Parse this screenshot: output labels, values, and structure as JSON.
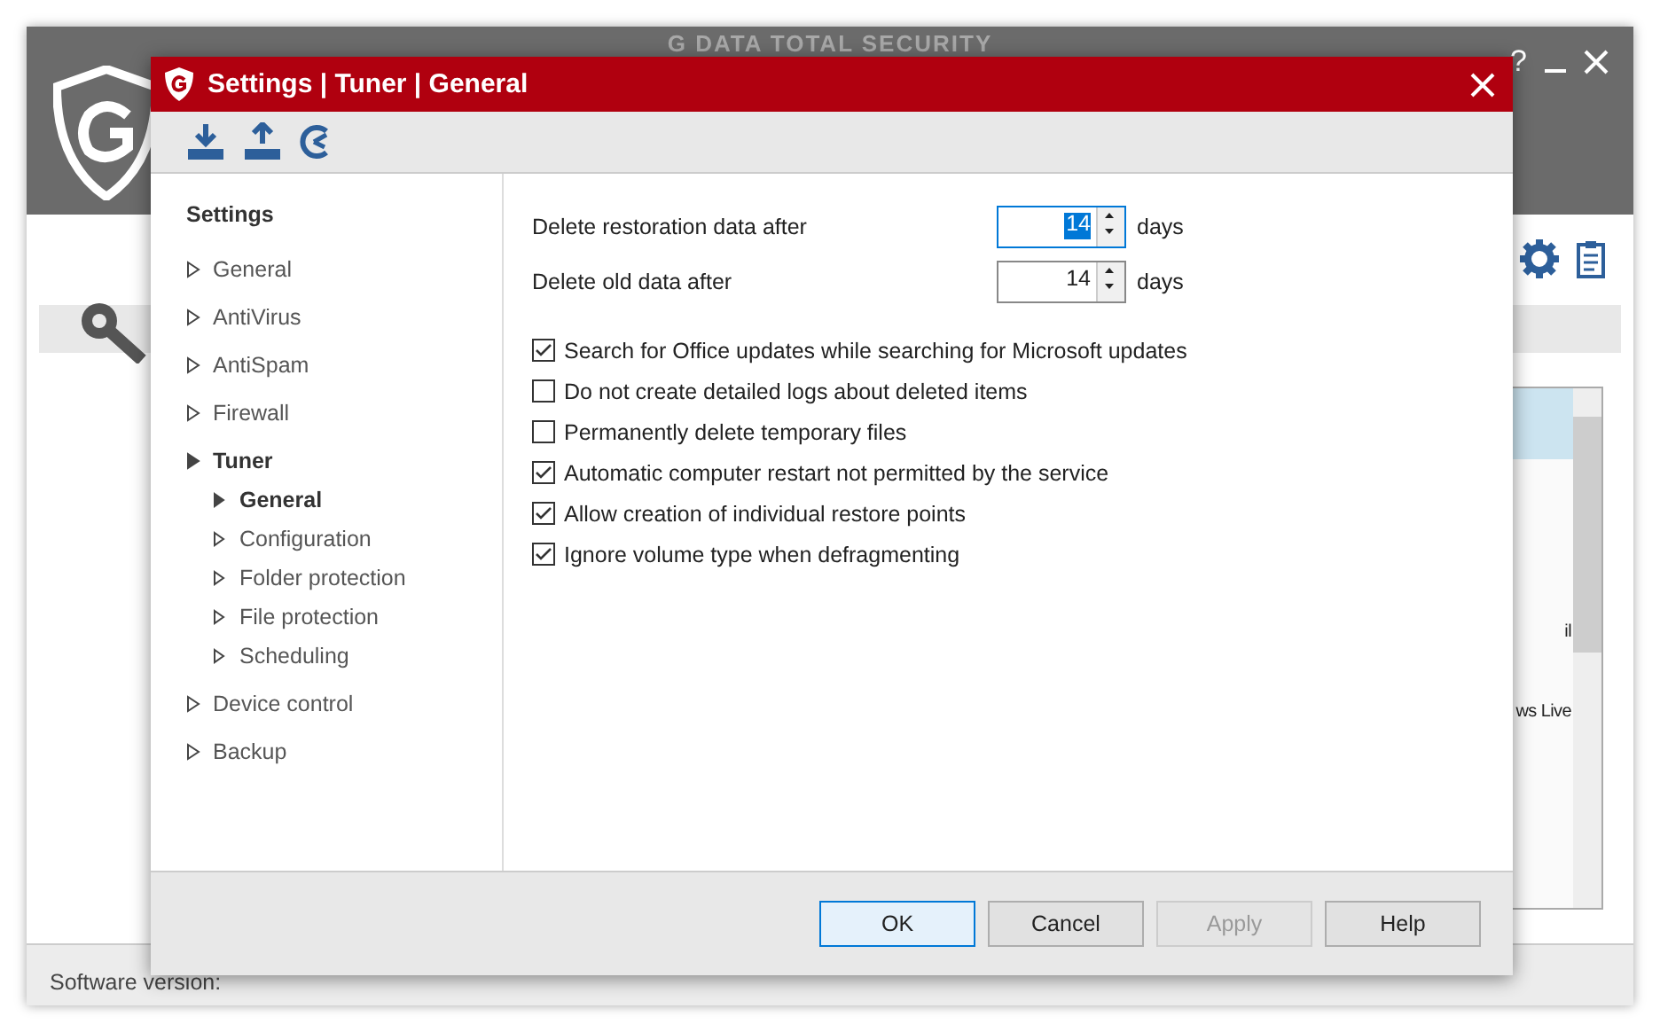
{
  "background_window": {
    "title": "G DATA TOTAL SECURITY",
    "help_label": "?",
    "list_items": [
      "il",
      "ws Live"
    ],
    "status": "Software version:"
  },
  "dialog": {
    "title": "Settings | Tuner | General",
    "nav": {
      "heading": "Settings",
      "items": [
        {
          "label": "General",
          "expanded": false
        },
        {
          "label": "AntiVirus",
          "expanded": false
        },
        {
          "label": "AntiSpam",
          "expanded": false
        },
        {
          "label": "Firewall",
          "expanded": false
        },
        {
          "label": "Tuner",
          "expanded": true,
          "children": [
            {
              "label": "General",
              "selected": true
            },
            {
              "label": "Configuration",
              "selected": false
            },
            {
              "label": "Folder protection",
              "selected": false
            },
            {
              "label": "File protection",
              "selected": false
            },
            {
              "label": "Scheduling",
              "selected": false
            }
          ]
        },
        {
          "label": "Device control",
          "expanded": false
        },
        {
          "label": "Backup",
          "expanded": false
        }
      ]
    },
    "spinners": [
      {
        "label": "Delete restoration data after",
        "value": "14",
        "unit": "days",
        "focused": true
      },
      {
        "label": "Delete old data after",
        "value": "14",
        "unit": "days",
        "focused": false
      }
    ],
    "checkboxes": [
      {
        "label": "Search for Office updates while searching for Microsoft updates",
        "checked": true
      },
      {
        "label": "Do not create detailed logs about deleted items",
        "checked": false
      },
      {
        "label": "Permanently delete temporary files",
        "checked": false
      },
      {
        "label": "Automatic computer restart not permitted by the service",
        "checked": true
      },
      {
        "label": "Allow creation of individual restore points",
        "checked": true
      },
      {
        "label": "Ignore volume type when defragmenting",
        "checked": true
      }
    ],
    "buttons": [
      {
        "label": "OK",
        "kind": "default",
        "disabled": false
      },
      {
        "label": "Cancel",
        "kind": "normal",
        "disabled": false
      },
      {
        "label": "Apply",
        "kind": "normal",
        "disabled": true
      },
      {
        "label": "Help",
        "kind": "normal",
        "disabled": false
      }
    ]
  }
}
